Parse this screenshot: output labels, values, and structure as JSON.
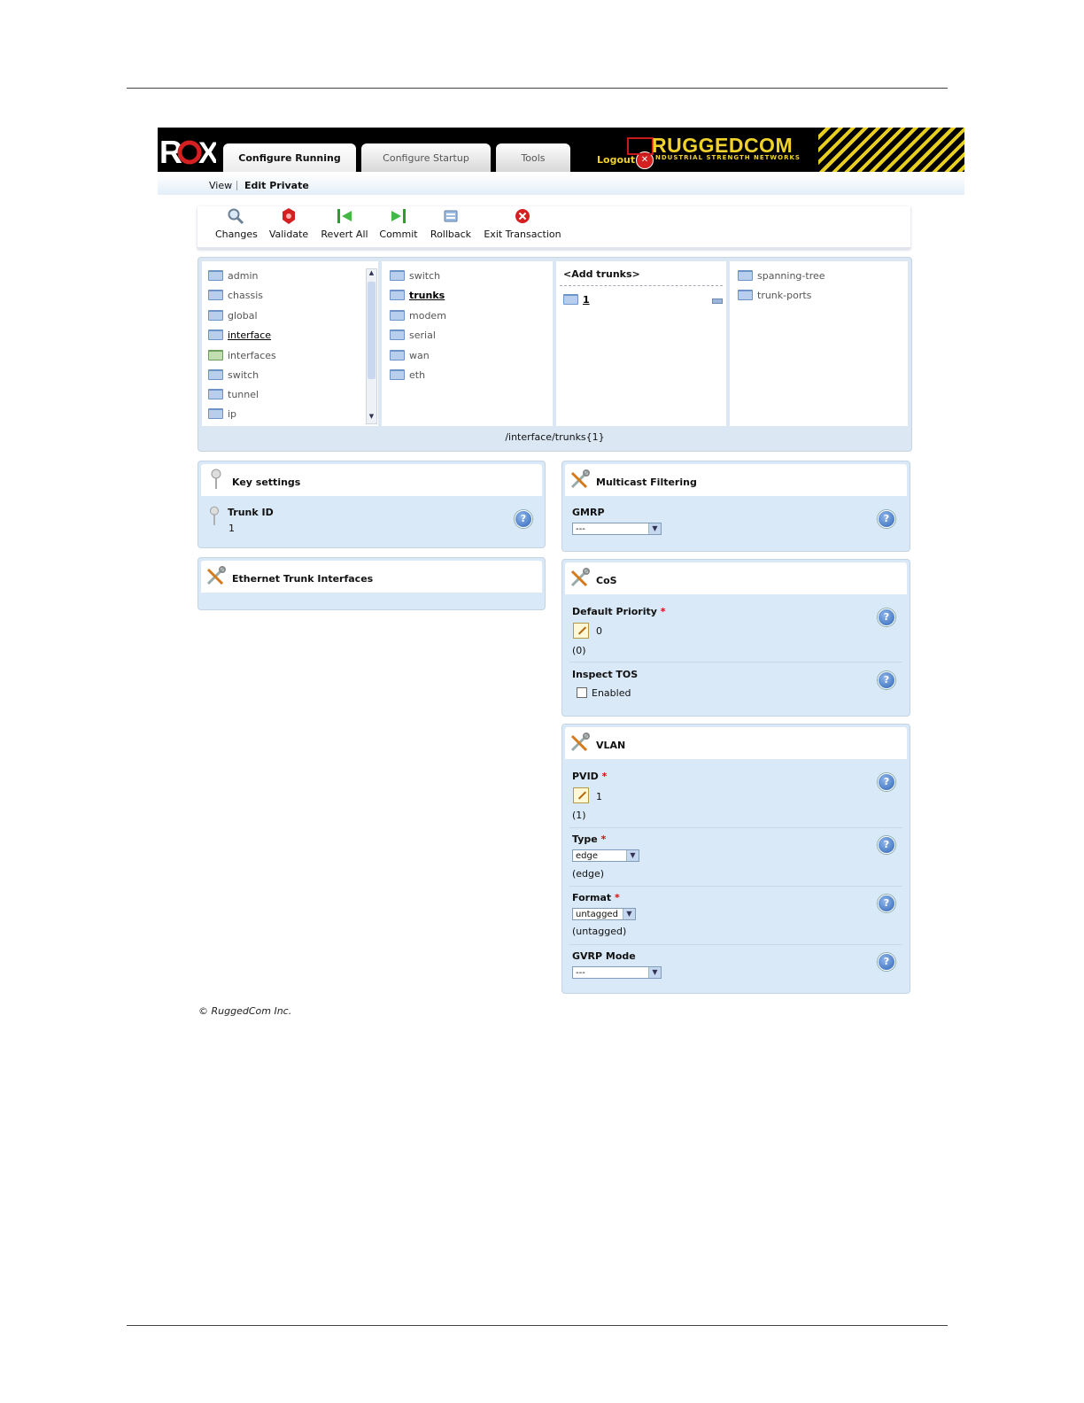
{
  "header": {
    "tabs": [
      {
        "label": "Configure Running",
        "active": true
      },
      {
        "label": "Configure Startup",
        "active": false
      },
      {
        "label": "Tools",
        "active": false
      }
    ],
    "logout_label": "Logout",
    "brand": "RUGGEDCOM",
    "tagline": "NDUSTRIAL STRENGTH NETWORKS",
    "brand_color": "#f0d12a"
  },
  "subnav": {
    "view": "View",
    "edit_private": "Edit Private"
  },
  "toolbar": {
    "changes": "Changes",
    "validate": "Validate",
    "revert_all": "Revert All",
    "commit": "Commit",
    "rollback": "Rollback",
    "exit_transaction": "Exit Transaction"
  },
  "browser": {
    "col1": [
      "admin",
      "chassis",
      "global",
      "interface",
      "interfaces",
      "switch",
      "tunnel",
      "ip"
    ],
    "col2": [
      "switch",
      "trunks",
      "modem",
      "serial",
      "wan",
      "eth"
    ],
    "col3_add": "<Add trunks>",
    "col3_item": "1",
    "col4": [
      "spanning-tree",
      "trunk-ports"
    ],
    "path": "/interface/trunks{1}"
  },
  "key_settings": {
    "title": "Key settings",
    "trunk_id_label": "Trunk ID",
    "trunk_id_value": "1"
  },
  "ethernet_trunk": {
    "title": "Ethernet Trunk Interfaces"
  },
  "multicast": {
    "title": "Multicast Filtering",
    "gmrp_label": "GMRP",
    "gmrp_value": "---"
  },
  "cos": {
    "title": "CoS",
    "default_priority_label": "Default Priority",
    "default_priority_value": "0",
    "default_priority_default": "(0)",
    "inspect_tos_label": "Inspect TOS",
    "inspect_tos_option": "Enabled"
  },
  "vlan": {
    "title": "VLAN",
    "pvid_label": "PVID",
    "pvid_value": "1",
    "pvid_default": "(1)",
    "type_label": "Type",
    "type_value": "edge",
    "type_default": "(edge)",
    "format_label": "Format",
    "format_value": "untagged",
    "format_default": "(untagged)",
    "gvrp_label": "GVRP Mode",
    "gvrp_value": "---"
  },
  "required_marker": "*",
  "help_glyph": "?",
  "footer": "© RuggedCom Inc."
}
